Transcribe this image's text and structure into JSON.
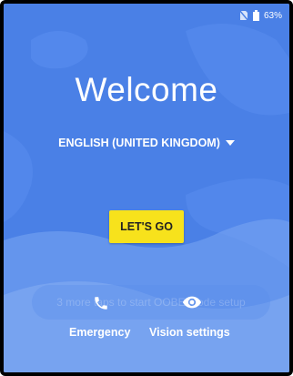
{
  "status": {
    "battery": "63%"
  },
  "title": "Welcome",
  "language": {
    "selected": "ENGLISH (UNITED KINGDOM)"
  },
  "primary_action": {
    "label": "LET'S GO"
  },
  "toast": {
    "text": "3 more taps to start OOBE mode setup"
  },
  "bottom": {
    "emergency_label": "Emergency",
    "vision_label": "Vision settings"
  },
  "colors": {
    "background": "#4a80e6",
    "button": "#f7e21c"
  },
  "icons": [
    "no-sim-icon",
    "battery-icon",
    "dropdown-arrow-icon",
    "phone-icon",
    "eye-icon"
  ]
}
